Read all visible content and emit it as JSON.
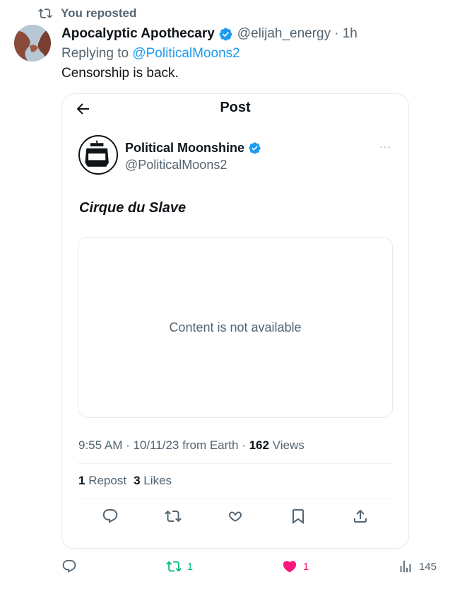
{
  "repost": {
    "label": "You reposted"
  },
  "tweet": {
    "name": "Apocalyptic Apothecary",
    "handle": "@elijah_energy",
    "time": "· 1h",
    "replying_prefix": "Replying to ",
    "replying_to": "@PoliticalMoons2",
    "text": "Censorship is back."
  },
  "quote": {
    "header_title": "Post",
    "name": "Political Moonshine",
    "handle": "@PoliticalMoons2",
    "more": "···",
    "text": "Cirque du Slave",
    "unavailable": "Content is not available",
    "timestamp": "9:55 AM · 10/11/23 from Earth · ",
    "views_count": "162",
    "views_label": " Views",
    "reposts_count": "1",
    "reposts_label": " Repost",
    "likes_count": "3",
    "likes_label": " Likes"
  },
  "bottom_bar": {
    "repost_count": "1",
    "like_count": "1",
    "views_count": "145"
  },
  "colors": {
    "accent": "#1d9bf0",
    "repost_green": "#00ba7c",
    "like_pink": "#f91880",
    "muted": "#536471"
  }
}
